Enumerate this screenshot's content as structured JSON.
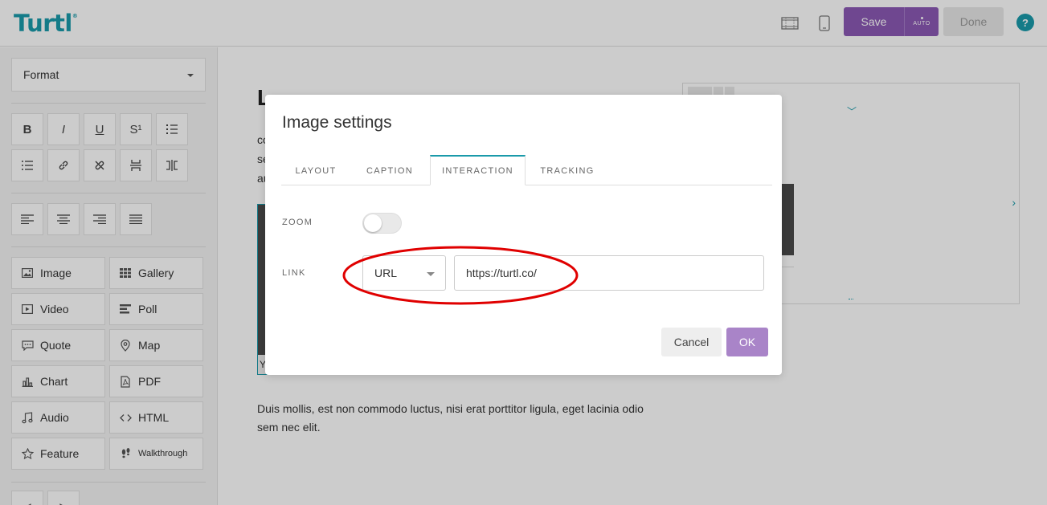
{
  "app": {
    "logo": "Turtl",
    "logo_mark": "®"
  },
  "topbar": {
    "save_label": "Save",
    "auto_label": "AUTO",
    "done_label": "Done",
    "help_label": "?"
  },
  "sidebar": {
    "format_label": "Format",
    "format_buttons": [
      "B",
      "I",
      "U",
      "S¹"
    ],
    "blocks": [
      {
        "label": "Image",
        "icon": "image-icon"
      },
      {
        "label": "Gallery",
        "icon": "gallery-icon"
      },
      {
        "label": "Video",
        "icon": "video-icon"
      },
      {
        "label": "Poll",
        "icon": "poll-icon"
      },
      {
        "label": "Quote",
        "icon": "quote-icon"
      },
      {
        "label": "Map",
        "icon": "map-pin-icon"
      },
      {
        "label": "Chart",
        "icon": "chart-icon"
      },
      {
        "label": "PDF",
        "icon": "pdf-icon"
      },
      {
        "label": "Audio",
        "icon": "audio-icon"
      },
      {
        "label": "HTML",
        "icon": "code-icon"
      },
      {
        "label": "Feature",
        "icon": "star-icon"
      },
      {
        "label": "Walkthrough",
        "icon": "footsteps-icon"
      }
    ]
  },
  "content": {
    "title": "L",
    "para_top": "co se au",
    "caption": "Yo",
    "paragraph": "Duis mollis, est non commodo luctus, nisi erat porttitor ligula, eget lacinia odio sem nec elit."
  },
  "modal": {
    "title": "Image settings",
    "tabs": [
      {
        "label": "LAYOUT",
        "active": false
      },
      {
        "label": "CAPTION",
        "active": false
      },
      {
        "label": "INTERACTION",
        "active": true
      },
      {
        "label": "TRACKING",
        "active": false
      }
    ],
    "zoom_label": "ZOOM",
    "zoom_on": false,
    "link_label": "LINK",
    "link_type": "URL",
    "link_value": "https://turtl.co/",
    "cancel_label": "Cancel",
    "ok_label": "OK"
  },
  "colors": {
    "brand": "#1a9aaa",
    "primary_button": "#8b59b4",
    "ok_button": "#a984c8",
    "annotation": "#e00000"
  }
}
